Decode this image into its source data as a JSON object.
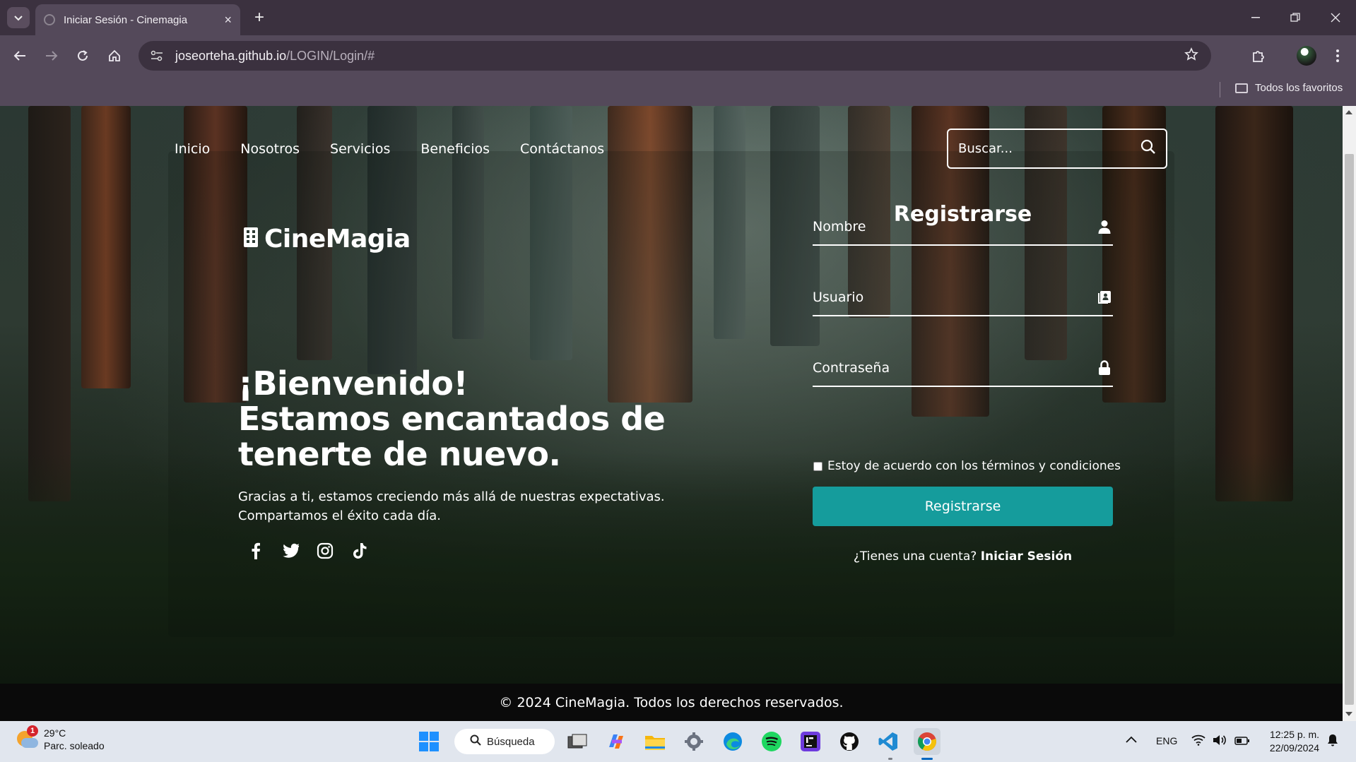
{
  "browser": {
    "tab_title": "Iniciar Sesión - Cinemagia",
    "url_host": "joseorteha.github.io",
    "url_path": "/LOGIN/Login/#",
    "bookmarks_label": "Todos los favoritos"
  },
  "nav": {
    "links": [
      "Inicio",
      "Nosotros",
      "Servicios",
      "Beneficios",
      "Contáctanos"
    ],
    "search_placeholder": "Buscar..."
  },
  "brand": {
    "name": "CineMagia"
  },
  "hero": {
    "title_line1": "¡Bienvenido!",
    "title_line2": "Estamos encantados de",
    "title_line3": "tenerte de nuevo.",
    "subtitle_line1": "Gracias a ti, estamos creciendo más allá de nuestras expectativas.",
    "subtitle_line2": "Compartamos el éxito cada día.",
    "socials": [
      "facebook-icon",
      "twitter-icon",
      "instagram-icon",
      "tiktok-icon"
    ]
  },
  "register_form": {
    "title": "Registrarse",
    "name_placeholder": "Nombre",
    "user_placeholder": "Usuario",
    "password_placeholder": "Contraseña",
    "terms_label": "Estoy de acuerdo con los términos y condiciones",
    "submit_label": "Registrarse",
    "login_prompt": "¿Tienes una cuenta?",
    "login_link": "Iniciar Sesión",
    "accent_color": "#159c9c"
  },
  "footer": {
    "text": "© 2024 CineMagia. Todos los derechos reservados."
  },
  "taskbar": {
    "weather_temp": "29°C",
    "weather_desc": "Parc. soleado",
    "weather_badge": "1",
    "search_label": "Búsqueda",
    "language": "ENG",
    "time": "12:25 p. m.",
    "date": "22/09/2024"
  }
}
